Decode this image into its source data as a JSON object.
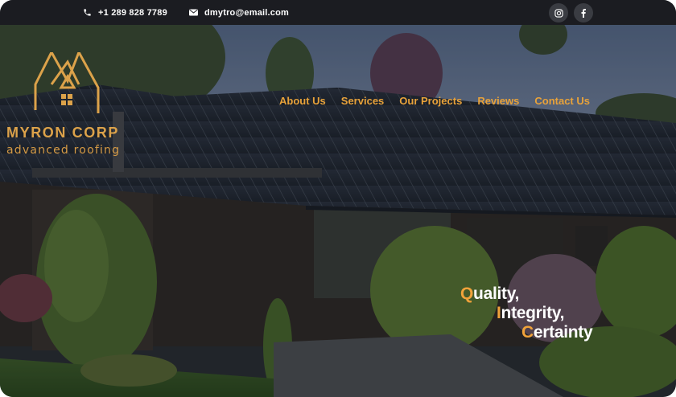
{
  "topbar": {
    "phone": "+1 289 828 7789",
    "email": "dmytro@email.com",
    "social": [
      "instagram-icon",
      "facebook-icon"
    ]
  },
  "brand": {
    "name": "MYRON CORP",
    "tagline": "advanced roofing",
    "accent": "#dca24a"
  },
  "nav": {
    "items": [
      "About Us",
      "Services",
      "Our Projects",
      "Reviews",
      "Contact Us"
    ],
    "color": "#e8a23a"
  },
  "hero": {
    "tagline": [
      {
        "first": "Q",
        "rest": "uality,"
      },
      {
        "first": "I",
        "rest": "ntegrity,"
      },
      {
        "first": "C",
        "rest": "ertainty"
      }
    ]
  }
}
